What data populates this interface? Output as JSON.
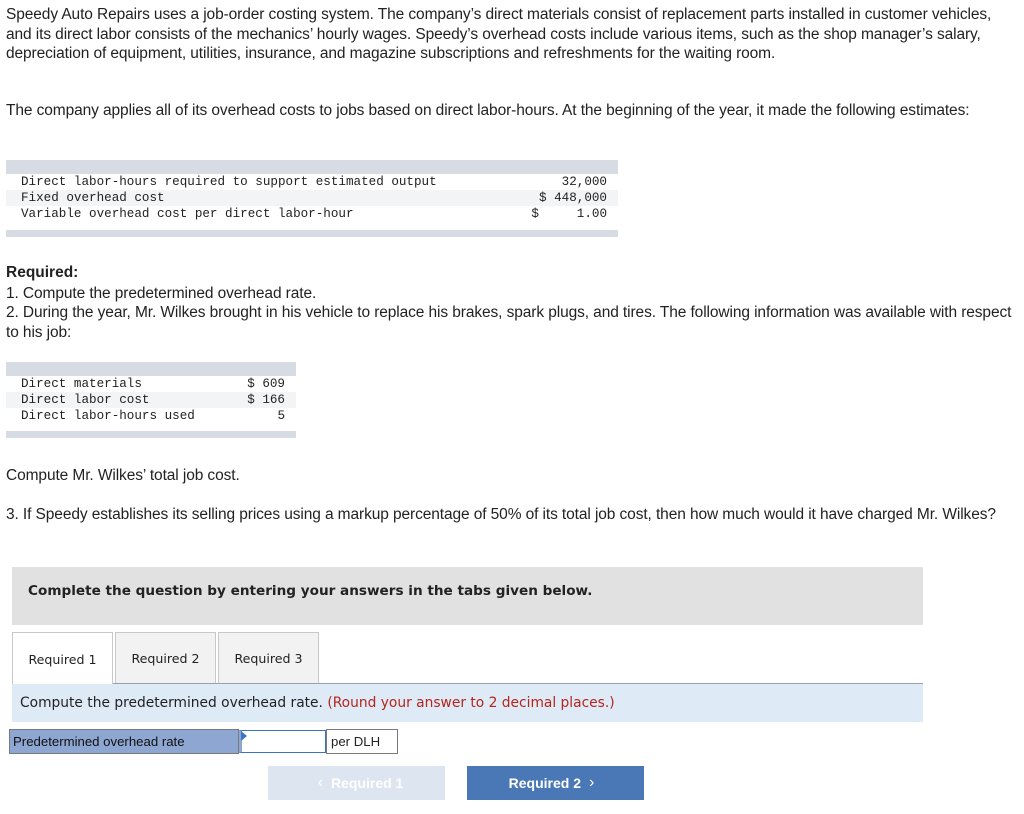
{
  "intro": {
    "paragraph1": "Speedy Auto Repairs uses a job-order costing system. The company’s direct materials consist of replacement parts installed in customer vehicles, and its direct labor consists of the mechanics’ hourly wages. Speedy’s overhead costs include various items, such as the shop manager’s salary, depreciation of equipment, utilities, insurance, and magazine subscriptions and refreshments for the waiting room.",
    "paragraph2": "The company applies all of its overhead costs to jobs based on direct labor-hours. At the beginning of the year, it made the following estimates:"
  },
  "estimates_table": {
    "rows": [
      {
        "label": "Direct labor-hours required to support estimated output",
        "value": "   32,000"
      },
      {
        "label": "Fixed overhead cost",
        "value": "$ 448,000"
      },
      {
        "label": "Variable overhead cost per direct labor-hour",
        "value": "$     1.00"
      }
    ]
  },
  "required": {
    "heading": "Required:",
    "item1": "1. Compute the predetermined overhead rate.",
    "item2": "2. During the year, Mr. Wilkes brought in his vehicle to replace his brakes, spark plugs, and tires. The following information was available with respect to his job:"
  },
  "job_table": {
    "rows": [
      {
        "label": "Direct materials",
        "value": "$ 609"
      },
      {
        "label": "Direct labor cost",
        "value": "$ 166"
      },
      {
        "label": "Direct labor-hours used",
        "value": "5"
      }
    ]
  },
  "compute_total": "Compute Mr. Wilkes’ total job cost.",
  "item3": "3. If Speedy establishes its selling prices using a markup percentage of 50% of its total job cost, then how much would it have charged Mr. Wilkes?",
  "banner": "Complete the question by entering your answers in the tabs given below.",
  "tabs": [
    {
      "label": "Required 1",
      "active": true
    },
    {
      "label": "Required 2",
      "active": false
    },
    {
      "label": "Required 3",
      "active": false
    }
  ],
  "instruction": {
    "text": "Compute the predetermined overhead rate.",
    "hint": "(Round your answer to 2 decimal places.)"
  },
  "answer": {
    "label": "Predetermined overhead rate",
    "value": "",
    "unit": "per DLH"
  },
  "navigation": {
    "prev_label": "Required 1",
    "next_label": "Required 2",
    "prev_icon": "chevron-left-icon",
    "next_icon": "chevron-right-icon"
  }
}
